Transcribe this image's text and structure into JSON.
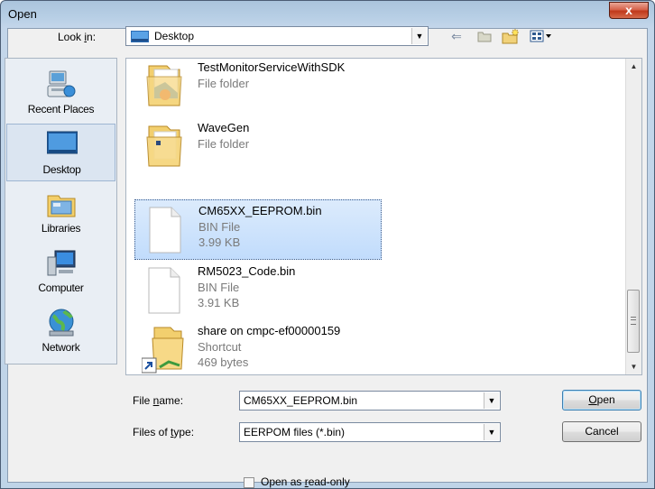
{
  "window": {
    "title": "Open",
    "close_label": "x"
  },
  "look_in": {
    "label_pre": "Look ",
    "label_key": "i",
    "label_post": "n:",
    "value": "Desktop"
  },
  "toolbar": {
    "back_icon": "back-arrow-icon",
    "up_icon": "up-folder-icon",
    "new_folder_icon": "new-folder-icon",
    "views_icon": "views-menu-icon"
  },
  "places": [
    {
      "label": "Recent Places",
      "icon": "recent-places-icon"
    },
    {
      "label": "Desktop",
      "icon": "desktop-icon",
      "selected": true
    },
    {
      "label": "Libraries",
      "icon": "libraries-icon"
    },
    {
      "label": "Computer",
      "icon": "computer-icon"
    },
    {
      "label": "Network",
      "icon": "network-icon"
    }
  ],
  "files": [
    {
      "name": "TestMonitorServiceWithSDK",
      "lines": [
        "File folder"
      ],
      "icon": "folder-icon"
    },
    {
      "name": "WaveGen",
      "lines": [
        "File folder"
      ],
      "icon": "folder-icon"
    },
    {
      "name": "CM65XX_EEPROM.bin",
      "lines": [
        "BIN File",
        "3.99 KB"
      ],
      "icon": "file-icon",
      "selected": true
    },
    {
      "name": "RM5023_Code.bin",
      "lines": [
        "BIN File",
        "3.91 KB"
      ],
      "icon": "file-icon"
    },
    {
      "name": "share on cmpc-ef00000159",
      "lines": [
        "Shortcut",
        "469 bytes"
      ],
      "icon": "shortcut-folder-icon"
    }
  ],
  "file_name": {
    "label_pre": "File ",
    "label_key": "n",
    "label_post": "ame:",
    "value": "CM65XX_EEPROM.bin"
  },
  "file_type": {
    "label_pre": "Files of ",
    "label_key": "t",
    "label_post": "ype:",
    "value": "EERPOM files (*.bin)"
  },
  "buttons": {
    "open_key": "O",
    "open_rest": "pen",
    "cancel": "Cancel"
  },
  "readonly": {
    "label_pre": "Open as ",
    "label_key": "r",
    "label_post": "ead-only",
    "checked": false
  },
  "scrollbar": {
    "position": 0.85
  }
}
